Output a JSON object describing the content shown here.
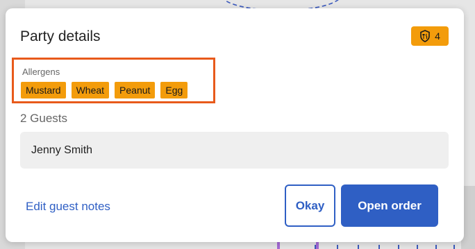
{
  "dialog": {
    "title": "Party details",
    "allergen_count": "4",
    "allergens_label": "Allergens",
    "allergens": [
      "Mustard",
      "Wheat",
      "Peanut",
      "Egg"
    ],
    "guests_count_label": "2 Guests",
    "guests": [
      {
        "name": "Jenny Smith"
      }
    ],
    "edit_notes_label": "Edit guest notes",
    "okay_label": "Okay",
    "open_order_label": "Open order"
  },
  "colors": {
    "accent_blue": "#2f5fc4",
    "allergen_orange": "#f39c0b",
    "highlight_border": "#e85a1b"
  },
  "icons": {
    "badge_icon": "allergen-shield-icon"
  }
}
